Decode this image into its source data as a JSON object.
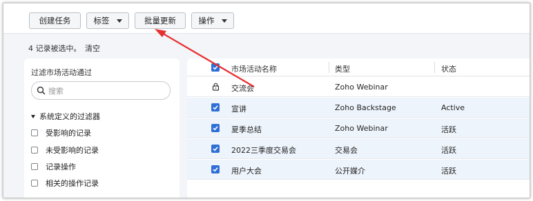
{
  "toolbar": {
    "create_task": "创建任务",
    "tags": "标签",
    "bulk_update": "批量更新",
    "actions": "操作"
  },
  "selection": {
    "text": "4 记录被选中。",
    "clear": "清空"
  },
  "filter_panel": {
    "title": "过滤市场活动通过",
    "search_placeholder": "搜索",
    "section": "系统定义的过滤器",
    "items": [
      "受影响的记录",
      "未受影响的记录",
      "记录操作",
      "相关的操作记录"
    ]
  },
  "table": {
    "headers": {
      "name": "市场活动名称",
      "type": "类型",
      "status": "状态"
    },
    "rows": [
      {
        "name": "交流会",
        "type": "Zoho Webinar",
        "status": "",
        "locked": true,
        "selected": false
      },
      {
        "name": "宣讲",
        "type": "Zoho Backstage",
        "status": "Active",
        "locked": false,
        "selected": true
      },
      {
        "name": "夏季总结",
        "type": "Zoho Webinar",
        "status": "活跃",
        "locked": false,
        "selected": true
      },
      {
        "name": "2022三季度交易会",
        "type": "交易会",
        "status": "活跃",
        "locked": false,
        "selected": true
      },
      {
        "name": "用户大会",
        "type": "公开媒介",
        "status": "活跃",
        "locked": false,
        "selected": true
      }
    ]
  },
  "colors": {
    "accent_blue": "#2f6fd6",
    "selected_row": "#eef4fc",
    "annotation_arrow": "#e53030"
  },
  "icons": [
    "caret-down-icon",
    "search-icon",
    "lock-icon",
    "checkbox-checked-icon",
    "annotation-arrow"
  ]
}
